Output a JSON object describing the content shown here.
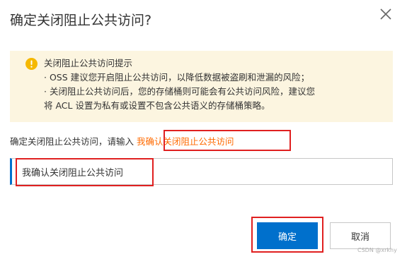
{
  "dialog": {
    "title": "确定关闭阻止公共访问?",
    "close_icon": "close-icon"
  },
  "warning": {
    "icon": "warning-icon",
    "icon_color": "#f5b800",
    "heading": "关闭阻止公共访问提示",
    "lines": [
      "· OSS 建议您开启阻止公共访问，以降低数据被盗刷和泄漏的风险；",
      "· 关闭阻止公共访问后，您的存储桶则可能会有公共访问风险，建议您",
      "将 ACL 设置为私有或设置不包含公共语义的存储桶策略。"
    ]
  },
  "instruction": {
    "prefix": "确定关闭阻止公共访问，请输入",
    "phrase": "我确认关闭阻止公共访问"
  },
  "input": {
    "value": "我确认关闭阻止公共访问"
  },
  "buttons": {
    "confirm": "确定",
    "cancel": "取消"
  },
  "colors": {
    "primary": "#0070cc",
    "phrase": "#ff6a00",
    "warning_bg": "#fcf5e0",
    "annotation": "#e02020"
  },
  "watermark": "CSDN @xrkhy"
}
